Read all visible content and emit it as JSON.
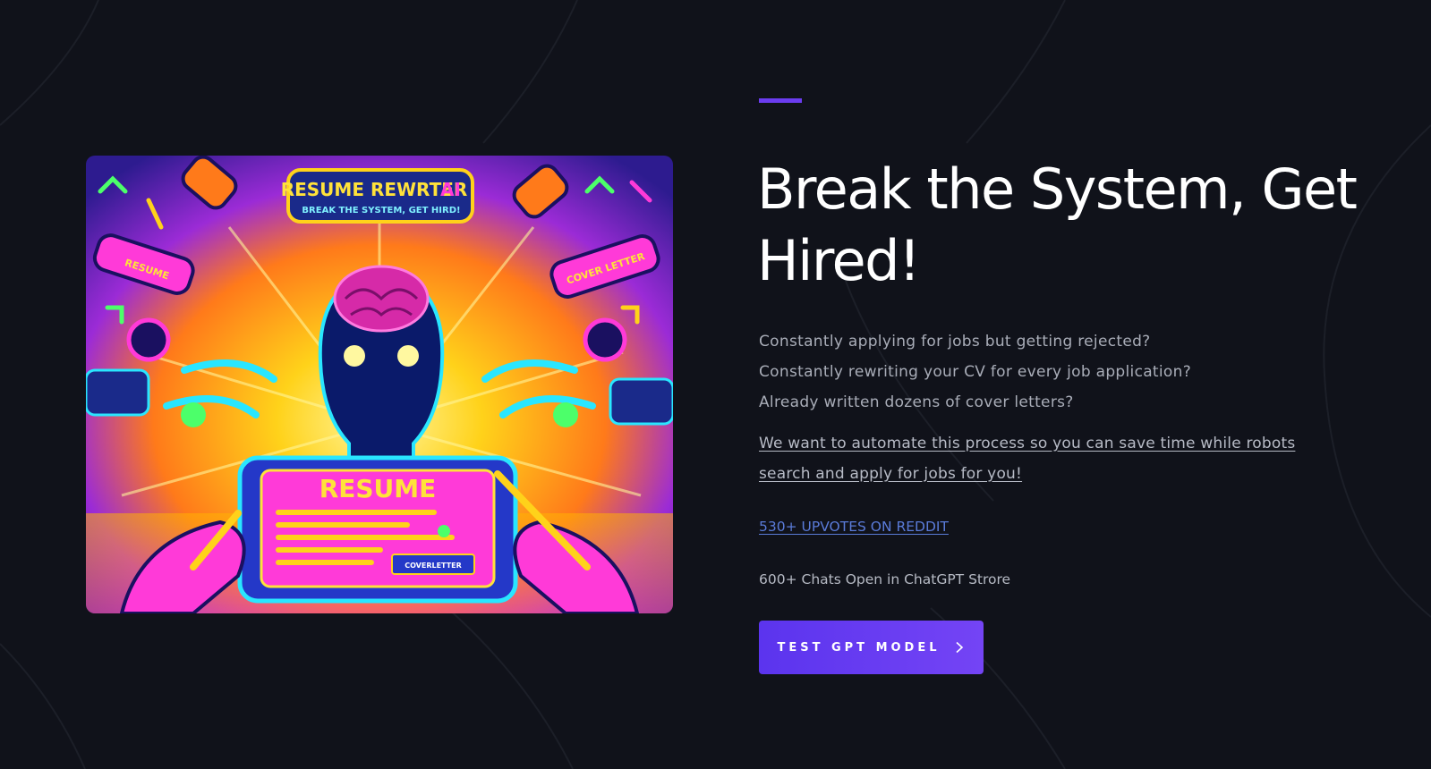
{
  "hero": {
    "image": {
      "alt_title": "RESUME REWRTER",
      "alt_title_suffix": "AI",
      "alt_subtitle": "BREAK THE SYSTEM, GET HIRD!",
      "card_title": "RESUME",
      "card_button": "COVERLETTER",
      "left_tag": "RESUME",
      "right_tag": "COVER LETTER"
    },
    "headline": "Break the System, Get Hired!",
    "pain_points": [
      "Constantly applying for jobs but getting rejected?",
      "Constantly rewriting your CV for every job application?",
      "Already written dozens of cover letters?"
    ],
    "pitch": "We want to automate this process so you can save time while robots search and apply for jobs for you!",
    "reddit_link": "530+ UPVOTES ON REDDIT",
    "chats_stat": "600+ Chats Open in ChatGPT Strore",
    "cta_label": "TEST GPT MODEL",
    "cta_icon": "chevron-right-icon"
  },
  "colors": {
    "background": "#10121a",
    "accent": "#6b3cf0",
    "link": "#5a7bd8"
  }
}
